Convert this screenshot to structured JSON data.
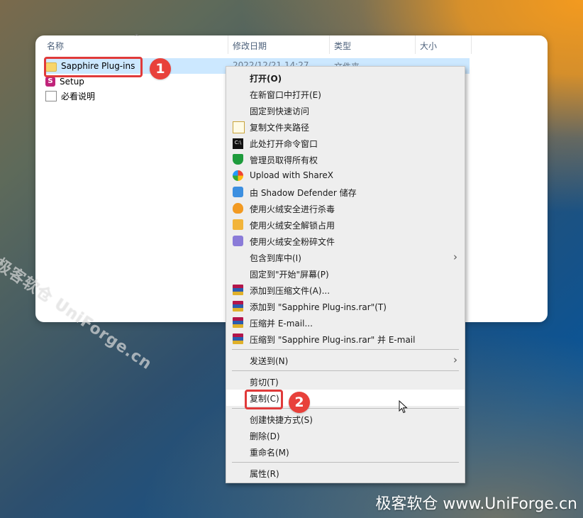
{
  "explorer": {
    "columns": [
      "名称",
      "修改日期",
      "类型",
      "大小"
    ],
    "files": [
      {
        "name": "Sapphire Plug-ins",
        "icon": "folder-icon",
        "date": "2022/12/21 14:27",
        "type": "文件夹"
      },
      {
        "name": "Setup",
        "icon": "setup-icon"
      },
      {
        "name": "必看说明",
        "icon": "document-icon"
      }
    ]
  },
  "badges": {
    "step1": "1",
    "step2": "2"
  },
  "context_menu": {
    "items": [
      {
        "label": "打开(O)",
        "icon": ""
      },
      {
        "label": "在新窗口中打开(E)",
        "icon": ""
      },
      {
        "label": "固定到快速访问",
        "icon": ""
      },
      {
        "label": "复制文件夹路径",
        "icon": "copy-path-icon"
      },
      {
        "label": "此处打开命令窗口",
        "icon": "cmd-icon"
      },
      {
        "label": "管理员取得所有权",
        "icon": "shield-icon"
      },
      {
        "label": "Upload with ShareX",
        "icon": "sharex-icon"
      },
      {
        "label": "由 Shadow Defender 储存",
        "icon": "shadow-defender-icon"
      },
      {
        "label": "使用火绒安全进行杀毒",
        "icon": "huorong-scan-icon"
      },
      {
        "label": "使用火绒安全解锁占用",
        "icon": "huorong-unlock-icon"
      },
      {
        "label": "使用火绒安全粉碎文件",
        "icon": "huorong-shred-icon"
      },
      {
        "label": "包含到库中(I)",
        "icon": ""
      },
      {
        "label": "固定到\"开始\"屏幕(P)",
        "icon": ""
      },
      {
        "label": "添加到压缩文件(A)...",
        "icon": "winrar-icon"
      },
      {
        "label": "添加到 \"Sapphire Plug-ins.rar\"(T)",
        "icon": "winrar-icon"
      },
      {
        "label": "压缩并 E-mail...",
        "icon": "winrar-icon"
      },
      {
        "label": "压缩到 \"Sapphire Plug-ins.rar\" 并 E-mail",
        "icon": "winrar-icon"
      },
      {
        "label": "发送到(N)",
        "icon": ""
      },
      {
        "label": "剪切(T)",
        "icon": ""
      },
      {
        "label": "复制(C)",
        "icon": ""
      },
      {
        "label": "创建快捷方式(S)",
        "icon": ""
      },
      {
        "label": "删除(D)",
        "icon": ""
      },
      {
        "label": "重命名(M)",
        "icon": ""
      },
      {
        "label": "属性(R)",
        "icon": ""
      }
    ]
  },
  "watermarks": {
    "rotated": "极客软仓 UniForge.cn",
    "corner": "极客软仓 www.UniForge.cn"
  },
  "colors": {
    "accent_red": "#e8413b",
    "selection": "#cce8ff",
    "menu_bg": "#eeeeee"
  }
}
